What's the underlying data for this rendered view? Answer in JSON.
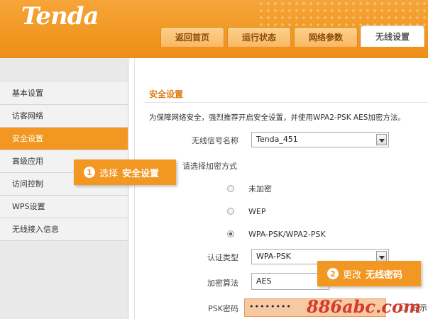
{
  "header": {
    "logo": "Tenda",
    "tabs": [
      {
        "label": "返回首页"
      },
      {
        "label": "运行状态"
      },
      {
        "label": "网络参数"
      },
      {
        "label": "无线设置",
        "active": true
      }
    ],
    "accent_color": "#f19722"
  },
  "sidebar": {
    "items": [
      {
        "label": "基本设置"
      },
      {
        "label": "访客网络"
      },
      {
        "label": "安全设置",
        "active": true
      },
      {
        "label": "高级应用"
      },
      {
        "label": "访问控制"
      },
      {
        "label": "WPS设置"
      },
      {
        "label": "无线接入信息"
      }
    ]
  },
  "main": {
    "section_title": "安全设置",
    "intro": "为保障网络安全，强烈推荐开启安全设置，并使用WPA2-PSK AES加密方法。",
    "ssid_label": "无线信号名称",
    "ssid_value": "Tenda_451",
    "encryption_prompt": "请选择加密方式",
    "encryption_options": [
      {
        "label": "未加密",
        "checked": false
      },
      {
        "label": "WEP",
        "checked": false
      },
      {
        "label": "WPA-PSK/WPA2-PSK",
        "checked": true
      }
    ],
    "auth_label": "认证类型",
    "auth_value": "WPA-PSK",
    "cipher_label": "加密算法",
    "cipher_value": "AES",
    "psk_label": "PSK密码",
    "psk_value": "••••••••",
    "show_label": "显示"
  },
  "callouts": [
    {
      "number": "1",
      "text": "选择",
      "strong": "安全设置"
    },
    {
      "number": "2",
      "text": "更改",
      "strong": "无线密码"
    }
  ],
  "watermark": "886abc.com"
}
